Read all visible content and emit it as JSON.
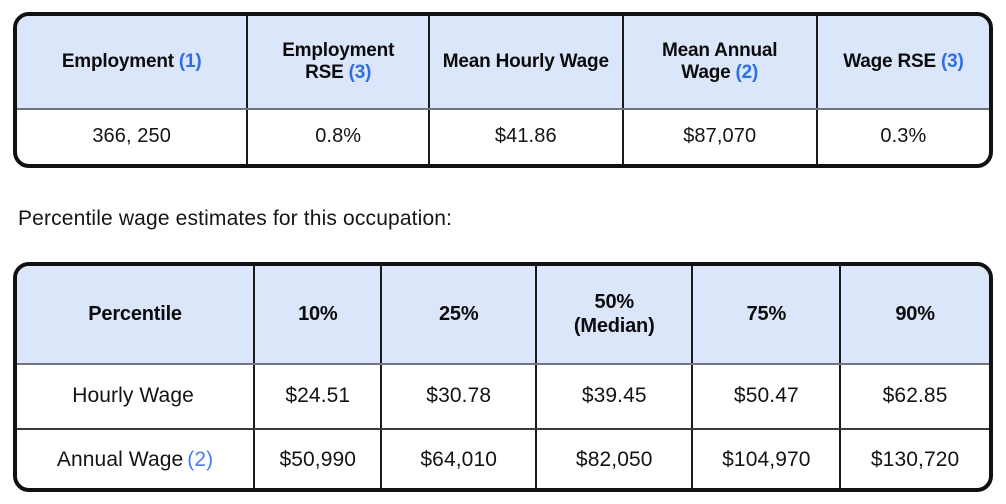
{
  "employment_table": {
    "name": "employment-and-wage-summary",
    "headers": [
      {
        "label": "Employment",
        "footnote": "(1)"
      },
      {
        "label": "Employment RSE",
        "footnote": "(3)"
      },
      {
        "label": "Mean Hourly Wage",
        "footnote": ""
      },
      {
        "label": "Mean Annual Wage",
        "footnote": "(2)"
      },
      {
        "label": "Wage RSE",
        "footnote": "(3)"
      }
    ],
    "row": {
      "employment": "366, 250",
      "employment_rse": "0.8%",
      "mean_hourly_wage": "$41.86",
      "mean_annual_wage": "$87,070",
      "wage_rse": "0.3%"
    }
  },
  "caption": "Percentile wage estimates for this occupation:",
  "percentile_table": {
    "name": "percentile-wage-estimates",
    "headers": [
      {
        "label": "Percentile",
        "sub": ""
      },
      {
        "label": "10%",
        "sub": ""
      },
      {
        "label": "25%",
        "sub": ""
      },
      {
        "label": "50%",
        "sub": "(Median)"
      },
      {
        "label": "75%",
        "sub": ""
      },
      {
        "label": "90%",
        "sub": ""
      }
    ],
    "rows": [
      {
        "label": "Hourly Wage",
        "footnote": "",
        "values": [
          "$24.51",
          "$30.78",
          "$39.45",
          "$50.47",
          "$62.85"
        ]
      },
      {
        "label": "Annual Wage",
        "footnote": "(2)",
        "values": [
          "$50,990",
          "$64,010",
          "$82,050",
          "$104,970",
          "$130,720"
        ]
      }
    ]
  },
  "colors": {
    "header_background": "#dce6fb",
    "border": "#111111",
    "footnote_blue": "#2f6fe0",
    "footnote_blue_light": "#4a7fe8",
    "header_divider": "#6f7681",
    "page_background": "#ffffff"
  }
}
